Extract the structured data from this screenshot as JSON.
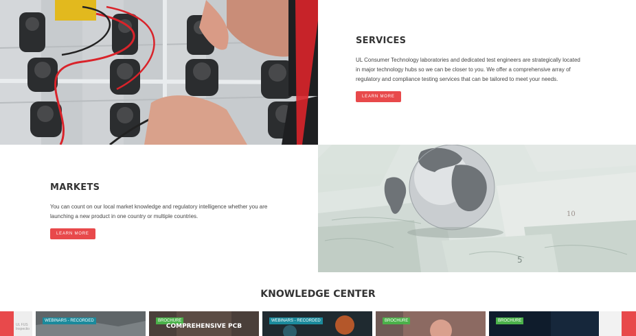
{
  "services": {
    "title": "SERVICES",
    "body": "UL Consumer Technology laboratories and dedicated test engineers are strategically located in major technology hubs so we can be closer to you. We offer a comprehensive array of regulatory and compliance testing services that can be tailored to meet your needs.",
    "button": "LEARN MORE"
  },
  "markets": {
    "title": "MARKETS",
    "body": "You can count on our local market knowledge and regulatory intelligence whether you are launching a new product in one country or multiple countries.",
    "button": "LEARN MORE"
  },
  "knowledge_center": {
    "title": "KNOWLEDGE CENTER",
    "ghost_text": "UL FUS\nInspectio",
    "cards": [
      {
        "tag": "WEBINARS - RECORDED",
        "title": ""
      },
      {
        "tag": "BROCHURE",
        "title": "COMPREHENSIVE PCB"
      },
      {
        "tag": "WEBINARS - RECORDED",
        "title": ""
      },
      {
        "tag": "BROCHURE",
        "title": ""
      },
      {
        "tag": "BROCHURE",
        "title": ""
      }
    ]
  },
  "colors": {
    "accent": "#e8494b",
    "tag_webinar": "#1b8a9c",
    "tag_brochure": "#4bb14a"
  },
  "images": {
    "photo1": "hands-testing-electrical-connectors",
    "photo2": "silver-globe-on-banknotes"
  }
}
